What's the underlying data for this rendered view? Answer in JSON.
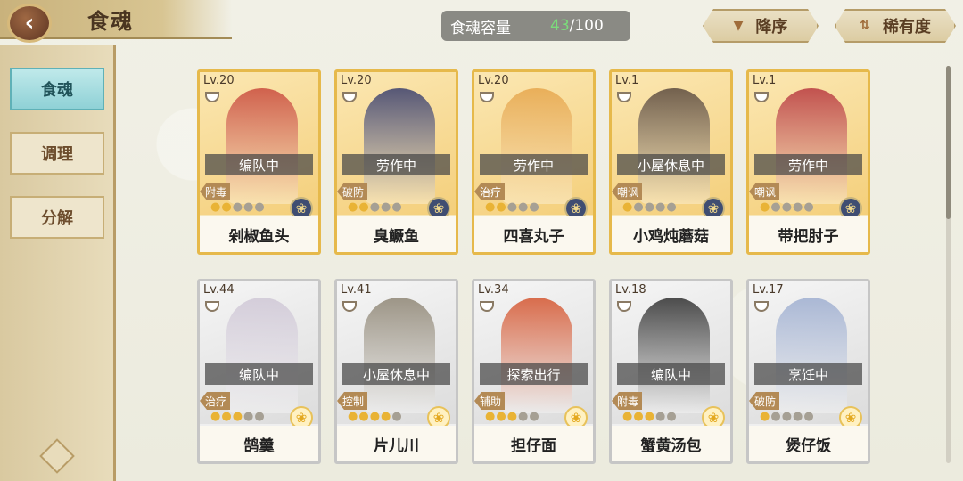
{
  "header": {
    "back_icon": "back-arrow-icon",
    "title": "食魂"
  },
  "sidebar": {
    "tabs": [
      {
        "label": "食魂",
        "active": true
      },
      {
        "label": "调理",
        "active": false
      },
      {
        "label": "分解",
        "active": false
      }
    ]
  },
  "capacity": {
    "label": "食魂容量",
    "current": "43",
    "max": "/100"
  },
  "sort": {
    "order_label": "降序",
    "order_icon": "triangle-down-icon",
    "key_label": "稀有度",
    "key_icon": "sort-arrows-icon"
  },
  "colors": {
    "accent": "#8fd1d6",
    "gold_frame": "#e6b94b",
    "silver_frame": "#c6c6c6",
    "capacity_current": "#7bdc7b"
  },
  "cards": [
    {
      "level": "Lv.20",
      "status": "编队中",
      "role": "附毒",
      "stars_on": 2,
      "rarity_icon": "dark",
      "name": "剁椒鱼头",
      "frame": "gold",
      "tint": "#c94b3d"
    },
    {
      "level": "Lv.20",
      "status": "劳作中",
      "role": "破防",
      "stars_on": 2,
      "rarity_icon": "dark",
      "name": "臭鳜鱼",
      "frame": "gold",
      "tint": "#3a3f6d"
    },
    {
      "level": "Lv.20",
      "status": "劳作中",
      "role": "治疗",
      "stars_on": 2,
      "rarity_icon": "dark",
      "name": "四喜丸子",
      "frame": "gold",
      "tint": "#e6a64c"
    },
    {
      "level": "Lv.1",
      "status": "小屋休息中",
      "role": "嘲讽",
      "stars_on": 1,
      "rarity_icon": "dark",
      "name": "小鸡炖蘑菇",
      "frame": "gold",
      "tint": "#5b4a3e"
    },
    {
      "level": "Lv.1",
      "status": "劳作中",
      "role": "嘲讽",
      "stars_on": 1,
      "rarity_icon": "dark",
      "name": "带把肘子",
      "frame": "gold",
      "tint": "#b8393f"
    },
    {
      "level": "Lv.44",
      "status": "编队中",
      "role": "治疗",
      "stars_on": 3,
      "rarity_icon": "yellow",
      "name": "鹄羹",
      "frame": "silver",
      "tint": "#cfc7d6"
    },
    {
      "level": "Lv.41",
      "status": "小屋休息中",
      "role": "控制",
      "stars_on": 4,
      "rarity_icon": "yellow",
      "name": "片儿川",
      "frame": "silver",
      "tint": "#8e8574"
    },
    {
      "level": "Lv.34",
      "status": "探索出行",
      "role": "辅助",
      "stars_on": 3,
      "rarity_icon": "yellow",
      "name": "担仔面",
      "frame": "silver",
      "tint": "#d4552f"
    },
    {
      "level": "Lv.18",
      "status": "编队中",
      "role": "附毒",
      "stars_on": 3,
      "rarity_icon": "yellow",
      "name": "蟹黄汤包",
      "frame": "silver",
      "tint": "#2f2f2f"
    },
    {
      "level": "Lv.17",
      "status": "烹饪中",
      "role": "破防",
      "stars_on": 1,
      "rarity_icon": "yellow",
      "name": "煲仔饭",
      "frame": "silver",
      "tint": "#9eaed0"
    }
  ],
  "scroll": {
    "position_fraction": 0.0
  }
}
